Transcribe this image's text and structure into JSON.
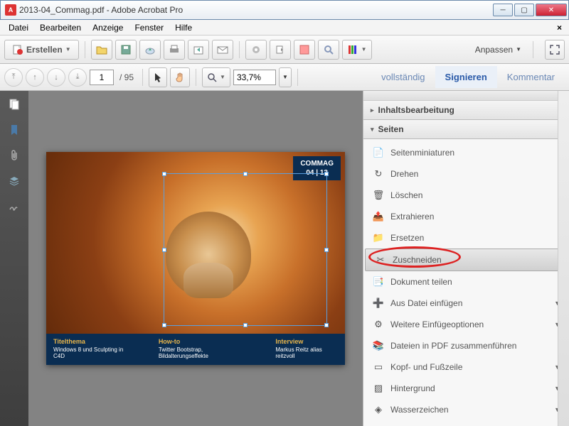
{
  "window": {
    "title": "2013-04_Commag.pdf - Adobe Acrobat Pro"
  },
  "menu": {
    "datei": "Datei",
    "bearbeiten": "Bearbeiten",
    "anzeige": "Anzeige",
    "fenster": "Fenster",
    "hilfe": "Hilfe"
  },
  "toolbar": {
    "create": "Erstellen",
    "anpassen": "Anpassen"
  },
  "nav": {
    "page_current": "1",
    "page_total": "/ 95",
    "zoom": "33,7%"
  },
  "rightlinks": {
    "voll": "vollständig",
    "sign": "Signieren",
    "komm": "Kommentar"
  },
  "panel": {
    "section1": "Inhaltsbearbeitung",
    "section2": "Seiten",
    "items": [
      {
        "label": "Seitenminiaturen",
        "icon": "📄"
      },
      {
        "label": "Drehen",
        "icon": "↻"
      },
      {
        "label": "Löschen",
        "icon": "🗑"
      },
      {
        "label": "Extrahieren",
        "icon": "📤"
      },
      {
        "label": "Ersetzen",
        "icon": "📁"
      },
      {
        "label": "Zuschneiden",
        "icon": "✂",
        "selected": true,
        "highlight": true
      },
      {
        "label": "Dokument teilen",
        "icon": "📑"
      },
      {
        "label": "Aus Datei einfügen",
        "icon": "➕",
        "expand": true
      },
      {
        "label": "Weitere Einfügeoptionen",
        "icon": "⚙",
        "expand": true
      },
      {
        "label": "Dateien in PDF zusammenführen",
        "icon": "📚"
      },
      {
        "label": "Kopf- und Fußzeile",
        "icon": "▭",
        "expand": true
      },
      {
        "label": "Hintergrund",
        "icon": "▨",
        "expand": true
      },
      {
        "label": "Wasserzeichen",
        "icon": "◈",
        "expand": true
      }
    ]
  },
  "document": {
    "badge_title": "COMMAG",
    "badge_sub": "04 | 13",
    "cols": [
      {
        "t": "Titelthema",
        "s": "Windows 8 und Sculpting in C4D"
      },
      {
        "t": "How-to",
        "s": "Twitter Bootstrap, Bildalterungseffekte"
      },
      {
        "t": "Interview",
        "s": "Markus Reitz alias reitzvoll"
      }
    ]
  }
}
